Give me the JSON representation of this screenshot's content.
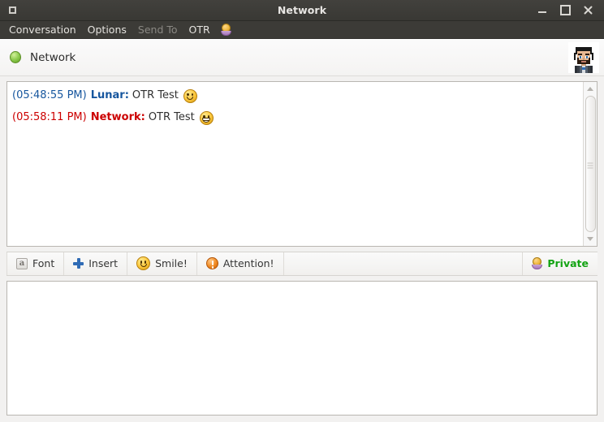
{
  "window": {
    "title": "Network",
    "icon": "window-menu-icon",
    "buttons": {
      "minimize": "minimize-button",
      "maximize": "maximize-button",
      "close": "close-button"
    }
  },
  "menubar": {
    "items": [
      {
        "label": "Conversation",
        "disabled": false
      },
      {
        "label": "Options",
        "disabled": false
      },
      {
        "label": "Send To",
        "disabled": true
      },
      {
        "label": "OTR",
        "disabled": false
      }
    ],
    "lock_icon": "otr-lock-icon"
  },
  "conversation_header": {
    "status": "available",
    "status_icon": "green-status-dot",
    "name": "Network",
    "avatar": "buddy-avatar"
  },
  "messages": [
    {
      "time": "(05:48:55 PM)",
      "sender": "Lunar:",
      "text": "OTR Test",
      "color": "#16569E",
      "emoticon": "smile"
    },
    {
      "time": "(05:58:11 PM)",
      "sender": "Network:",
      "text": "OTR Test",
      "color": "#CC0000",
      "emoticon": "grin"
    }
  ],
  "scrollbar": {
    "up_arrow": "scroll-up-arrow",
    "down_arrow": "scroll-down-arrow",
    "thumb": "scroll-thumb"
  },
  "toolbar": {
    "buttons": [
      {
        "label": "Font",
        "icon": "font-icon",
        "glyph": "a"
      },
      {
        "label": "Insert",
        "icon": "insert-plus-icon"
      },
      {
        "label": "Smile!",
        "icon": "smiley-icon"
      },
      {
        "label": "Attention!",
        "icon": "attention-icon"
      }
    ],
    "status": {
      "label": "Private",
      "icon": "otr-lock-icon",
      "color": "#13A313"
    }
  },
  "input": {
    "value": "",
    "placeholder": ""
  }
}
